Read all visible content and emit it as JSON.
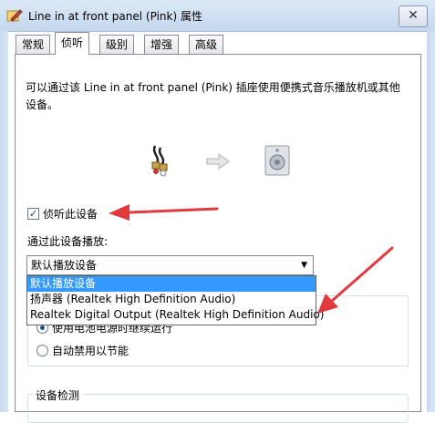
{
  "window": {
    "title": "Line in at front panel (Pink) 属性",
    "close_label": "✕"
  },
  "tabs": [
    {
      "label": "常规"
    },
    {
      "label": "侦听"
    },
    {
      "label": "级别"
    },
    {
      "label": "增强"
    },
    {
      "label": "高级"
    }
  ],
  "active_tab": "侦听",
  "listen": {
    "description": "可以通过该 Line in at front panel (Pink) 插座使用便携式音乐播放机或其他设备。",
    "checkbox_label": "侦听此设备",
    "checkbox_checked": true,
    "play_through_label": "通过此设备播放:",
    "select_value": "默认播放设备",
    "dropdown_options": [
      "默认播放设备",
      "扬声器 (Realtek High Definition Audio)",
      "Realtek Digital Output (Realtek High Definition Audio)"
    ],
    "selected_option_index": 0
  },
  "power": {
    "option_1": "使用电池电源时继续运行",
    "option_2": "自动禁用以节能",
    "selected_option": 1
  },
  "device_detection": {
    "label": "设备检测"
  },
  "icons": {
    "title": "properties-icon",
    "source": "audio-cable-icon",
    "flow": "arrow-right-icon",
    "target": "speaker-icon"
  },
  "colors": {
    "annotation_arrow": "#e0393e",
    "selection": "#3399ff"
  }
}
